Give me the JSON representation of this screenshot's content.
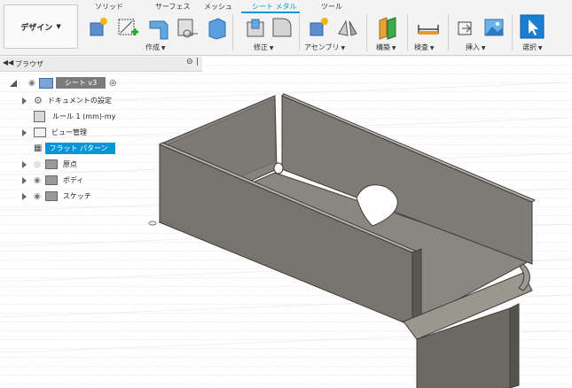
{
  "workspace": {
    "label": "デザイン"
  },
  "tabs": [
    {
      "label": "ソリッド"
    },
    {
      "label": "サーフェス"
    },
    {
      "label": "メッシュ"
    },
    {
      "label": "シート メタル",
      "active": true
    },
    {
      "label": "ツール"
    }
  ],
  "groups": {
    "create": "作成",
    "modify": "修正",
    "assemble": "アセンブリ",
    "construct": "構築",
    "inspect": "検査",
    "insert": "挿入",
    "select": "選択"
  },
  "browser": {
    "title": "ブラウザ",
    "root": "シート v3",
    "items": [
      {
        "label": "ドキュメントの設定"
      },
      {
        "label": "ルール 1 (mm)-my"
      },
      {
        "label": "ビュー管理"
      },
      {
        "label": "フラット パターン"
      },
      {
        "label": "原点"
      },
      {
        "label": "ボディ"
      },
      {
        "label": "スケッチ"
      }
    ]
  },
  "colors": {
    "accent": "#0696d7",
    "selected_bg": "#0696d7",
    "part_face": "#7b7872",
    "part_edge": "#3e3c39"
  }
}
